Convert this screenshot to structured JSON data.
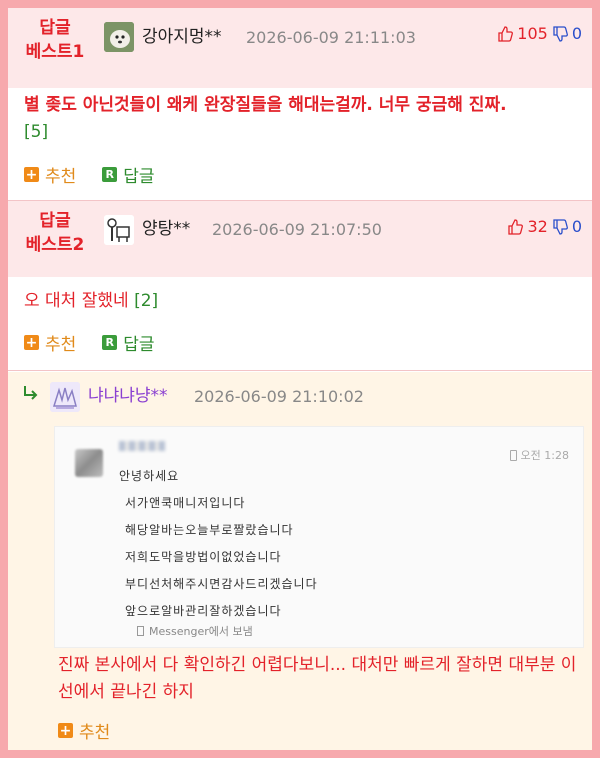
{
  "comments": [
    {
      "badge_line1": "답글",
      "badge_line2": "베스트1",
      "nickname": "강아지멍**",
      "datetime": "2026-06-09 21:11:03",
      "up": "105",
      "down": "0",
      "text": "별 좆도 아닌것들이 왜케 완장질들을 해대는걸까. 너무 궁금해 진짜.",
      "reply_count": "[5]",
      "recommend_label": "추천",
      "reply_label": "답글"
    },
    {
      "badge_line1": "답글",
      "badge_line2": "베스트2",
      "nickname": "양탕**",
      "datetime": "2026-06-09 21:07:50",
      "up": "32",
      "down": "0",
      "text": "오 대처 잘했네",
      "reply_count": "[2]",
      "recommend_label": "추천",
      "reply_label": "답글"
    }
  ],
  "reply": {
    "nickname": "냐냐냐냥**",
    "datetime": "2026-06-09 21:10:02",
    "text": "진짜 본사에서 다 확인하긴 어렵다보니... 대처만 빠르게 잘하면 대부분 이 선에서 끝나긴 하지",
    "recommend_label": "추천",
    "screenshot": {
      "time": "오전 1:28",
      "lines": [
        "안녕하세요",
        "서가앤쿡매니저입니다",
        "해당알바는오늘부로짤랐습니다",
        "저희도막을방법이없었습니다",
        "부디선처해주시면감사드리겠습니다",
        "앞으로알바관리잘하겠습니다"
      ],
      "footer": "Messenger에서 보냄"
    }
  },
  "colors": {
    "accent_red": "#e3222a",
    "vote_blue": "#2a4ecb",
    "green": "#2e8b2e",
    "orange": "#e08a1a",
    "nick_purple": "#8a3fd1"
  },
  "icons": [
    "thumbs-up-icon",
    "thumbs-down-icon",
    "plus-icon",
    "reply-r-icon",
    "reply-arrow-icon",
    "phone-icon"
  ]
}
